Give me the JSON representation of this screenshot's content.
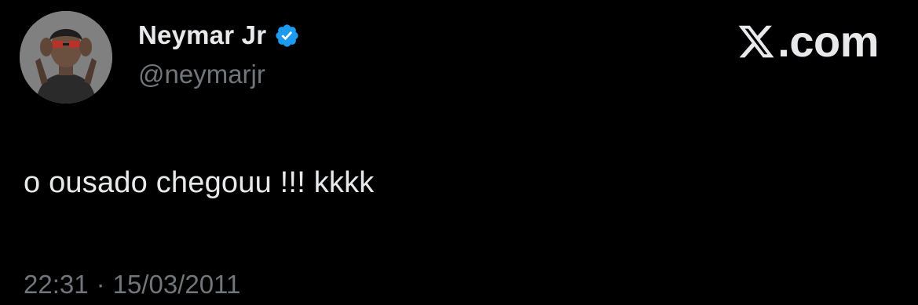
{
  "author": {
    "display_name": "Neymar Jr",
    "handle": "@neymarjr",
    "verified_icon": "verified-badge-icon"
  },
  "brand": {
    "logo_icon": "x-logo-icon",
    "suffix": ".com"
  },
  "tweet": {
    "text": "o ousado chegouu !!! kkkk",
    "time": "22:31",
    "separator": "·",
    "date": "15/03/2011"
  },
  "colors": {
    "background": "#000000",
    "primary_text": "#e7e9ea",
    "secondary_text": "#71767b",
    "verified_blue": "#1d9bf0"
  }
}
